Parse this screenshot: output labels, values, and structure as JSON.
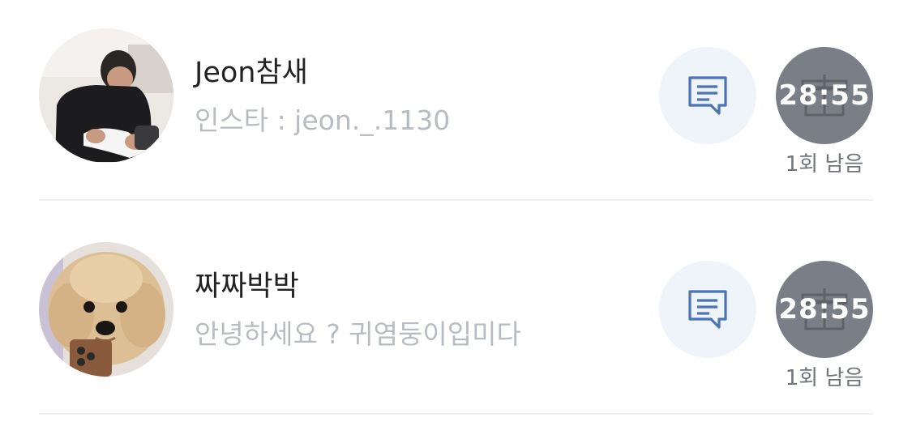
{
  "colors": {
    "name_text": "#222222",
    "bio_text": "#b7bcc3",
    "chat_button_bg": "#eff4fa",
    "chat_icon": "#4a73b8",
    "timer_button_bg": "#797e87",
    "remaining_text": "#6f747b",
    "divider": "#edeff2"
  },
  "users": [
    {
      "name": "Jeon참새",
      "bio": "인스타 : jeon._.1130",
      "avatar_icon": "person-photo",
      "chat_icon": "message-icon",
      "timer": "28:55",
      "timer_icon": "gift-icon",
      "remaining": "1회 남음"
    },
    {
      "name": "짜짜박박",
      "bio": "안녕하세요 ? 귀염둥이입미다",
      "avatar_icon": "dog-photo",
      "chat_icon": "message-icon",
      "timer": "28:55",
      "timer_icon": "gift-icon",
      "remaining": "1회 남음"
    }
  ]
}
